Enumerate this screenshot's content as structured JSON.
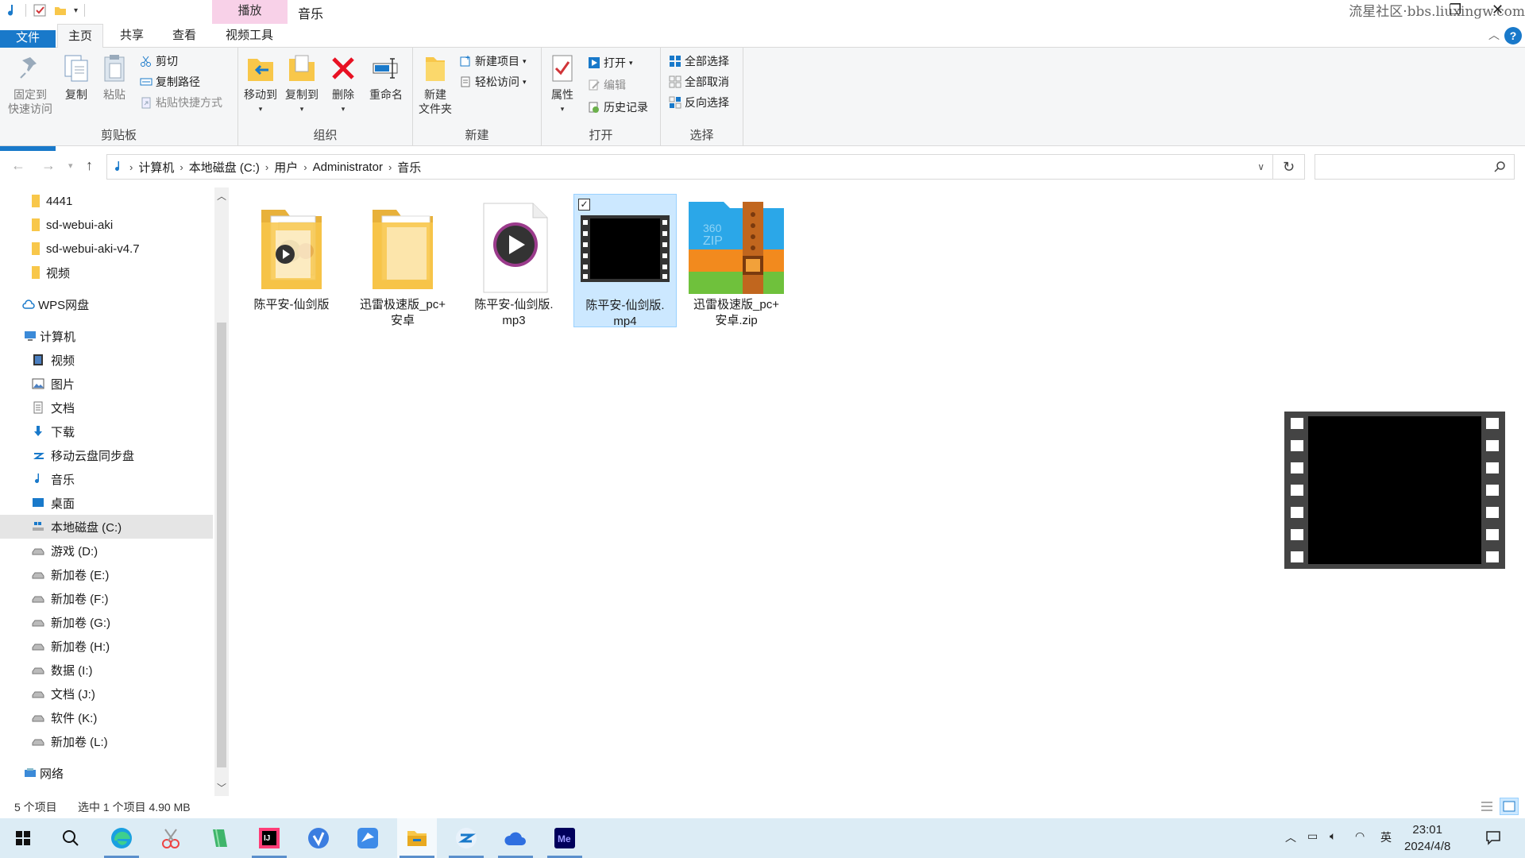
{
  "titlebar": {
    "context_tab": "播放",
    "window_title": "音乐",
    "watermark": "流星社区·bbs.liuxingw.com"
  },
  "tabs": {
    "file": "文件",
    "home": "主页",
    "share": "共享",
    "view": "查看",
    "video_tools": "视频工具"
  },
  "ribbon": {
    "clipboard": {
      "label": "剪贴板",
      "pin": "固定到\n快速访问",
      "pin_line1": "固定到",
      "pin_line2": "快速访问",
      "copy": "复制",
      "paste": "粘贴",
      "cut": "剪切",
      "copy_path": "复制路径",
      "paste_shortcut": "粘贴快捷方式"
    },
    "organize": {
      "label": "组织",
      "move_to": "移动到",
      "copy_to": "复制到",
      "delete": "删除",
      "rename": "重命名"
    },
    "new": {
      "label": "新建",
      "new_folder_line1": "新建",
      "new_folder_line2": "文件夹",
      "new_item": "新建项目",
      "easy_access": "轻松访问"
    },
    "open": {
      "label": "打开",
      "properties": "属性",
      "open": "打开",
      "edit": "编辑",
      "history": "历史记录"
    },
    "select": {
      "label": "选择",
      "select_all": "全部选择",
      "select_none": "全部取消",
      "invert": "反向选择"
    }
  },
  "address": {
    "crumbs": [
      "计算机",
      "本地磁盘 (C:)",
      "用户",
      "Administrator",
      "音乐"
    ],
    "search_placeholder": ""
  },
  "sidebar": {
    "items": [
      {
        "label": "4441",
        "icon": "folder-icon"
      },
      {
        "label": "sd-webui-aki",
        "icon": "folder-icon"
      },
      {
        "label": "sd-webui-aki-v4.7",
        "icon": "folder-icon"
      },
      {
        "label": "视频",
        "icon": "folder-icon"
      },
      {
        "label": "WPS网盘",
        "icon": "cloud-icon"
      },
      {
        "label": "计算机",
        "icon": "computer-icon"
      },
      {
        "label": "视频",
        "icon": "video-icon"
      },
      {
        "label": "图片",
        "icon": "pictures-icon"
      },
      {
        "label": "文档",
        "icon": "documents-icon"
      },
      {
        "label": "下载",
        "icon": "download-icon"
      },
      {
        "label": "移动云盘同步盘",
        "icon": "cloud-sync-icon"
      },
      {
        "label": "音乐",
        "icon": "music-icon"
      },
      {
        "label": "桌面",
        "icon": "desktop-icon"
      },
      {
        "label": "本地磁盘 (C:)",
        "icon": "drive-icon"
      },
      {
        "label": "游戏 (D:)",
        "icon": "drive-icon"
      },
      {
        "label": "新加卷 (E:)",
        "icon": "drive-icon"
      },
      {
        "label": "新加卷 (F:)",
        "icon": "drive-icon"
      },
      {
        "label": "新加卷 (G:)",
        "icon": "drive-icon"
      },
      {
        "label": "新加卷 (H:)",
        "icon": "drive-icon"
      },
      {
        "label": "数据 (I:)",
        "icon": "drive-icon"
      },
      {
        "label": "文档 (J:)",
        "icon": "drive-icon"
      },
      {
        "label": "软件 (K:)",
        "icon": "drive-icon"
      },
      {
        "label": "新加卷 (L:)",
        "icon": "drive-icon"
      },
      {
        "label": "网络",
        "icon": "network-icon"
      }
    ]
  },
  "files": [
    {
      "line1": "陈平安-仙剑版",
      "line2": "",
      "type": "folder-video"
    },
    {
      "line1": "迅雷极速版_pc+",
      "line2": "安卓",
      "type": "folder"
    },
    {
      "line1": "陈平安-仙剑版.",
      "line2": "mp3",
      "type": "audio"
    },
    {
      "line1": "陈平安-仙剑版.",
      "line2": "mp4",
      "type": "video",
      "selected": true
    },
    {
      "line1": "迅雷极速版_pc+",
      "line2": "安卓.zip",
      "type": "zip"
    }
  ],
  "status": {
    "count": "5 个项目",
    "selection": "选中 1 个项目  4.90 MB"
  },
  "taskbar": {
    "clock_time": "23:01",
    "clock_date": "2024/4/8",
    "ime": "英"
  },
  "colors": {
    "accent": "#1979ca",
    "selection": "#cce8ff",
    "context_tab": "#f8d1e8",
    "taskbar": "#dcecf5"
  }
}
